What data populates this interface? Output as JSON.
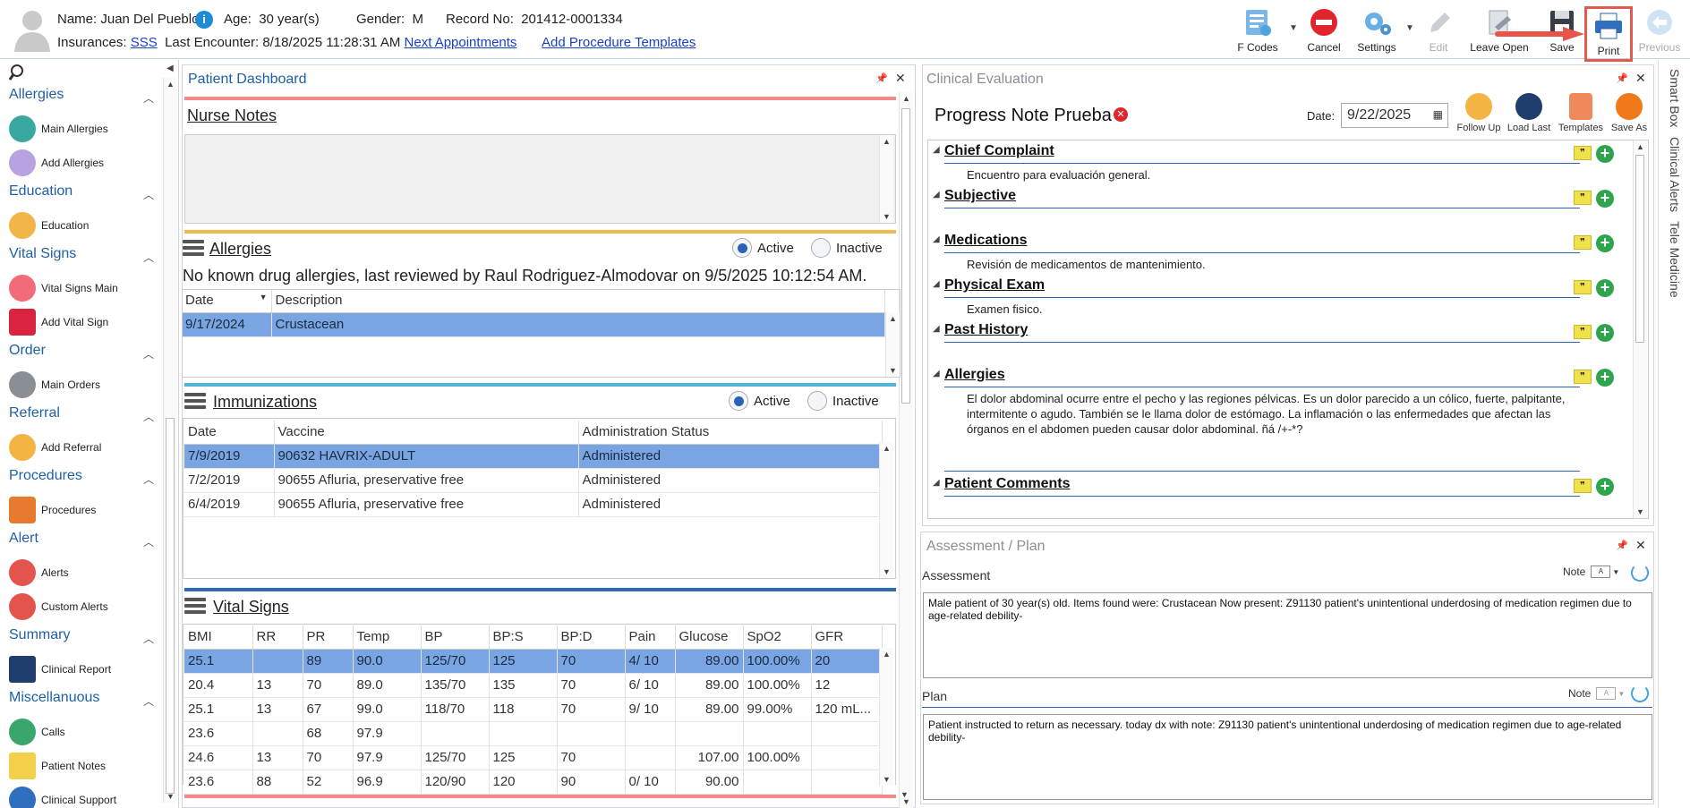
{
  "patient": {
    "name_label": "Name:",
    "name": "Juan Del Pueblo",
    "age_label": "Age:",
    "age": "30 year(s)",
    "gender_label": "Gender:",
    "gender": "M",
    "record_label": "Record No:",
    "record": "201412-0001334",
    "ins_label": "Insurances:",
    "insurance": "SSS",
    "last_enc_label": "Last Encounter:",
    "last_enc": "8/18/2025 11:28:31 AM",
    "next_appt": "Next Appointments",
    "add_proc": "Add Procedure Templates",
    "info": "i"
  },
  "toolbar": {
    "fcodes": "F Codes",
    "cancel": "Cancel",
    "settings": "Settings",
    "edit": "Edit",
    "leave_open": "Leave Open",
    "save": "Save",
    "print": "Print",
    "previous": "Previous"
  },
  "sidebar": {
    "allergies": {
      "title": "Allergies",
      "items": [
        "Main Allergies",
        "Add Allergies"
      ]
    },
    "education": {
      "title": "Education",
      "items": [
        "Education"
      ]
    },
    "vital": {
      "title": "Vital Signs",
      "items": [
        "Vital Signs Main",
        "Add Vital Sign"
      ]
    },
    "order": {
      "title": "Order",
      "items": [
        "Main Orders"
      ]
    },
    "referral": {
      "title": "Referral",
      "items": [
        "Add Referral"
      ]
    },
    "procedures": {
      "title": "Procedures",
      "items": [
        "Procedures"
      ]
    },
    "alert": {
      "title": "Alert",
      "items": [
        "Alerts",
        "Custom Alerts"
      ]
    },
    "summary": {
      "title": "Summary",
      "items": [
        "Clinical Report"
      ]
    },
    "misc": {
      "title": "Miscellanuous",
      "items": [
        "Calls",
        "Patient Notes",
        "Clinical Support"
      ]
    }
  },
  "dashboard": {
    "title": "Patient Dashboard",
    "nurse_notes": "Nurse Notes",
    "allergies": {
      "title": "Allergies",
      "active": "Active",
      "inactive": "Inactive",
      "summary": "No known drug allergies, last reviewed by Raul Rodriguez-Almodovar on 9/5/2025 10:12:54 AM.",
      "cols": [
        "Date",
        "Description"
      ],
      "rows": [
        [
          "9/17/2024",
          "Crustacean"
        ]
      ]
    },
    "immunizations": {
      "title": "Immunizations",
      "active": "Active",
      "inactive": "Inactive",
      "cols": [
        "Date",
        "Vaccine",
        "Administration Status"
      ],
      "rows": [
        [
          "7/9/2019",
          "90632 HAVRIX-ADULT",
          "Administered"
        ],
        [
          "7/2/2019",
          "90655 Afluria, preservative free",
          "Administered"
        ],
        [
          "6/4/2019",
          "90655 Afluria, preservative free",
          "Administered"
        ]
      ]
    },
    "vitals": {
      "title": "Vital Signs",
      "cols": [
        "BMI",
        "RR",
        "PR",
        "Temp",
        "BP",
        "BP:S",
        "BP:D",
        "Pain",
        "Glucose",
        "SpO2",
        "GFR"
      ],
      "rows": [
        [
          "25.1",
          "",
          "89",
          "90.0",
          "125/70",
          "125",
          "70",
          "4/ 10",
          "89.00",
          "100.00%",
          "20"
        ],
        [
          "20.4",
          "13",
          "70",
          "89.0",
          "135/70",
          "135",
          "70",
          "6/ 10",
          "89.00",
          "100.00%",
          "12"
        ],
        [
          "25.1",
          "13",
          "67",
          "99.0",
          "118/70",
          "118",
          "70",
          "9/ 10",
          "89.00",
          "99.00%",
          "120 mL..."
        ],
        [
          "23.6",
          "",
          "68",
          "97.9",
          "",
          "",
          "",
          "",
          "",
          "",
          ""
        ],
        [
          "24.6",
          "13",
          "70",
          "97.9",
          "125/70",
          "125",
          "70",
          "",
          "107.00",
          "100.00%",
          ""
        ],
        [
          "23.6",
          "88",
          "52",
          "96.9",
          "120/90",
          "120",
          "90",
          "0/ 10",
          "90.00",
          "",
          ""
        ]
      ]
    }
  },
  "clinical": {
    "title": "Clinical Evaluation",
    "note_title": "Progress Note Prueba",
    "date_label": "Date:",
    "date": "9/22/2025",
    "actions": [
      "Follow Up",
      "Load Last",
      "Templates",
      "Save As"
    ],
    "sections": [
      {
        "h": "Chief Complaint",
        "t": "Encuentro para evaluación general."
      },
      {
        "h": "Subjective",
        "t": ""
      },
      {
        "h": "Medications",
        "t": "Revisión de medicamentos de mantenimiento."
      },
      {
        "h": "Physical Exam",
        "t": "Examen fisico."
      },
      {
        "h": "Past History",
        "t": ""
      },
      {
        "h": "Allergies",
        "t": "El dolor abdominal ocurre entre el pecho y las regiones pélvicas. Es un dolor parecido a un cólico, fuerte, palpitante, intermitente o agudo. También se le llama dolor de estómago. La inflamación o las enfermedades que afectan las órganos en el abdomen pueden causar dolor abdominal. ñá /+-*?"
      },
      {
        "h": "Patient Comments",
        "t": ""
      }
    ]
  },
  "assessment": {
    "title": "Assessment / Plan",
    "assessment_label": "Assessment",
    "note_label": "Note",
    "assessment_text": "Male patient of 30 year(s) old. Items found were:  Crustacean  Now present:  Z91130 patient's unintentional underdosing of medication regimen due to age-related debility-",
    "plan_label": "Plan",
    "plan_text": " Patient instructed to return as necessary.  today dx with note:  Z91130 patient's unintentional underdosing of medication regimen due to age-related debility-"
  },
  "rightbar": {
    "items": [
      "Smart Box",
      "Clinical Alerts",
      "Tele Medicine"
    ]
  }
}
